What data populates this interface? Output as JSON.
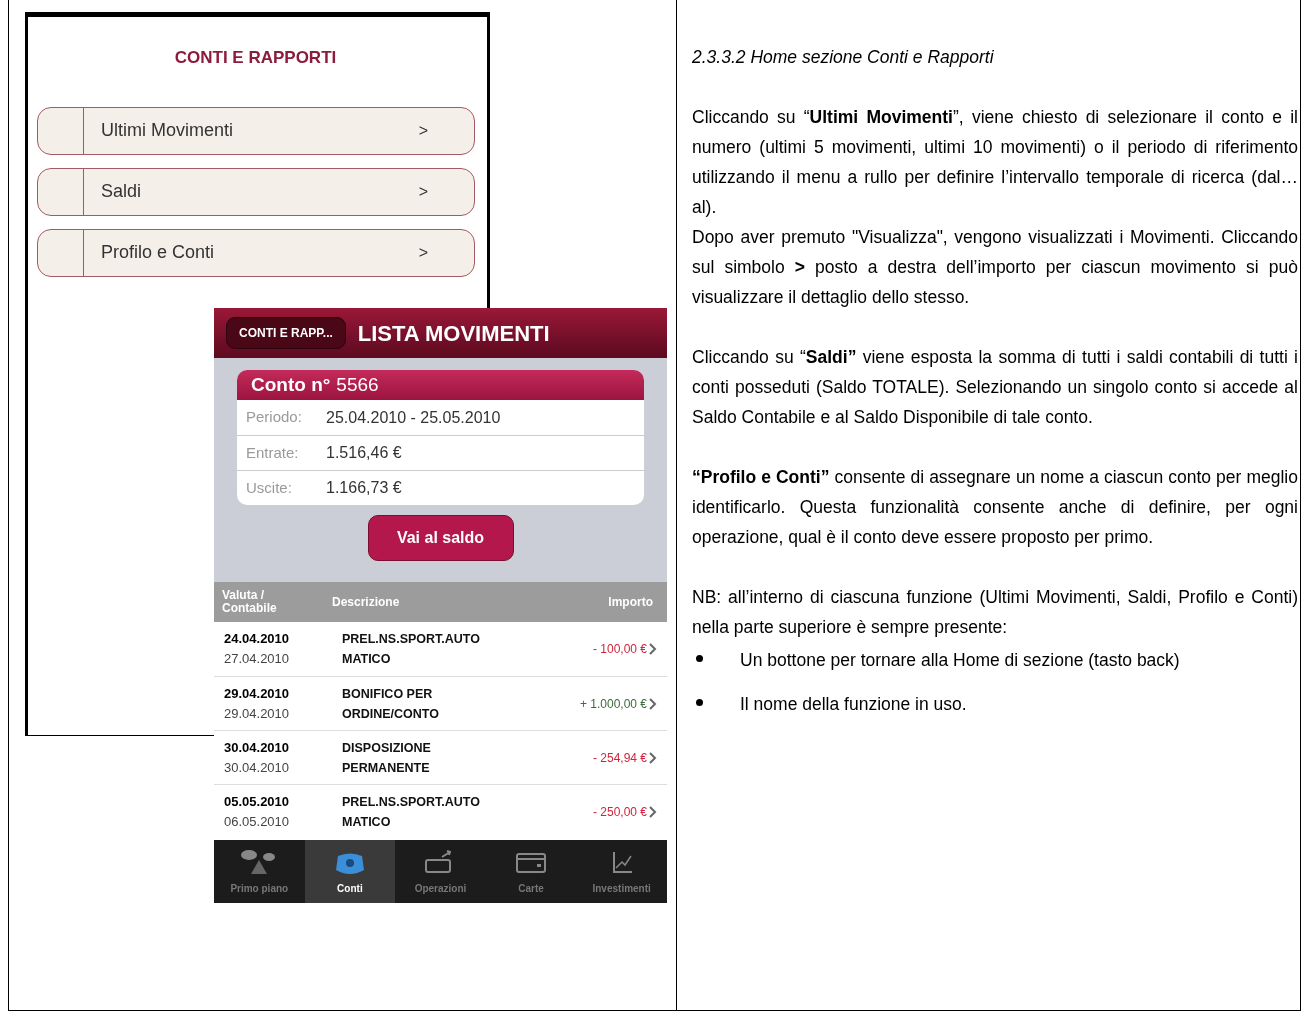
{
  "menu_screen": {
    "title": "CONTI E RAPPORTI",
    "items": [
      {
        "label": "Ultimi Movimenti",
        "chevron": ">"
      },
      {
        "label": "Saldi",
        "chevron": ">"
      },
      {
        "label": "Profilo e Conti",
        "chevron": ">"
      }
    ]
  },
  "phone_screen": {
    "back_button": "CONTI E RAPP...",
    "title": "LISTA MOVIMENTI",
    "account": {
      "label": "Conto n°",
      "number": "5566",
      "fields": [
        {
          "label": "Periodo:",
          "value": "25.04.2010 - 25.05.2010"
        },
        {
          "label": "Entrate:",
          "value": "1.516,46 €"
        },
        {
          "label": "Uscite:",
          "value": "1.166,73 €"
        }
      ]
    },
    "action_button": "Vai al saldo",
    "table": {
      "columns": [
        "Valuta / Contabile",
        "Descrizione",
        "Importo"
      ],
      "rows": [
        {
          "value_date": "24.04.2010",
          "booking_date": "27.04.2010",
          "description": "PREL.NS.SPORT.AUTO\nMATICO",
          "amount": "- 100,00 €",
          "kind": "debit"
        },
        {
          "value_date": "29.04.2010",
          "booking_date": "29.04.2010",
          "description": "BONIFICO PER\nORDINE/CONTO",
          "amount": "+ 1.000,00 €",
          "kind": "credit"
        },
        {
          "value_date": "30.04.2010",
          "booking_date": "30.04.2010",
          "description": "DISPOSIZIONE\nPERMANENTE",
          "amount": "- 254,94 €",
          "kind": "debit"
        },
        {
          "value_date": "05.05.2010",
          "booking_date": "06.05.2010",
          "description": "PREL.NS.SPORT.AUTO\nMATICO",
          "amount": "- 250,00 €",
          "kind": "debit"
        }
      ]
    },
    "tab_bar": [
      {
        "label": "Primo piano",
        "selected": false
      },
      {
        "label": "Conti",
        "selected": true
      },
      {
        "label": "Operazioni",
        "selected": false
      },
      {
        "label": "Carte",
        "selected": false
      },
      {
        "label": "Investimenti",
        "selected": false
      }
    ]
  },
  "description": {
    "heading": "2.3.3.2 Home sezione Conti e Rapporti",
    "blocks": [
      [
        "Cliccando su “**Ultimi Movimenti**”, viene chiesto di selezionare il conto e il numero (ultimi 5 movimenti, ultimi 10 movimenti) o il periodo di riferimento utilizzando il menu a rullo per definire l’intervallo temporale di ricerca (dal… al).",
        "Dopo aver premuto \"Visualizza\", vengono visualizzati i Movimenti. Cliccando sul simbolo **>** posto a destra dell’importo per ciascun movimento si può visualizzare il dettaglio dello stesso."
      ],
      [
        "Cliccando su “**Saldi”** viene esposta la somma di tutti i saldi contabili di tutti i conti posseduti (Saldo TOTALE).    Selezionando un singolo conto si accede al Saldo Contabile e al Saldo Disponibile di tale conto."
      ],
      [
        "**“Profilo e Conti”** consente di assegnare un nome a ciascun conto per meglio identificarlo.  Questa funzionalità consente anche di  definire,  per ogni operazione,  qual è il conto deve essere proposto per primo."
      ],
      [
        "NB: all’interno di ciascuna funzione (Ultimi Movimenti, Saldi, Profilo e Conti) nella parte superiore è sempre presente:"
      ]
    ],
    "bullets": [
      "Un bottone per tornare alla Home di sezione (tasto back)",
      "Il nome della funzione in uso."
    ]
  }
}
